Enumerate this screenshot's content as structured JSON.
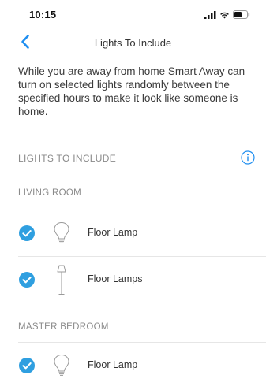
{
  "status_bar": {
    "time": "10:15"
  },
  "nav": {
    "title": "Lights To Include",
    "back_icon": "chevron-left-icon"
  },
  "intro_text": "While you are away from home Smart Away can turn on selected lights randomly between the specified hours to make it look like someone is home.",
  "section": {
    "title": "LIGHTS TO INCLUDE",
    "info_icon": "info-circle-icon"
  },
  "rooms": [
    {
      "name": "LIVING ROOM",
      "lights": [
        {
          "label": "Floor Lamp",
          "icon": "light-bulb-icon",
          "selected": true
        },
        {
          "label": "Floor Lamps",
          "icon": "floor-lamp-icon",
          "selected": true
        }
      ]
    },
    {
      "name": "MASTER BEDROOM",
      "lights": [
        {
          "label": "Floor Lamp",
          "icon": "light-bulb-icon",
          "selected": true
        }
      ]
    }
  ],
  "colors": {
    "accent": "#1e8ef0",
    "checkmark": "#2f9fe0",
    "text": "#333333",
    "muted": "#8a8a8a",
    "divider": "#e6e6e6"
  }
}
